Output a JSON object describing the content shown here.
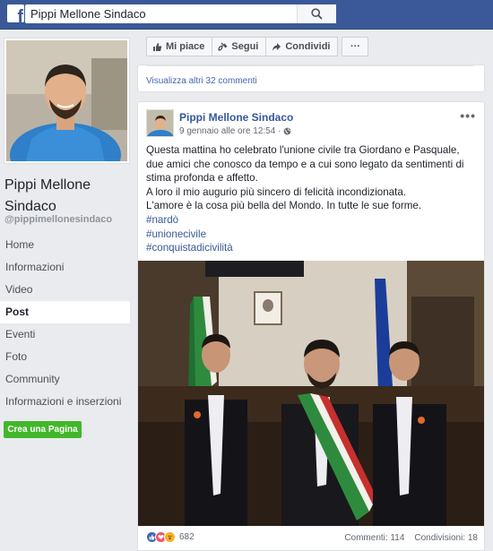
{
  "search": {
    "value": "Pippi Mellone Sindaco",
    "logo": "f"
  },
  "profile": {
    "name": "Pippi Mellone Sindaco",
    "handle": "@pippimellonesindaco"
  },
  "nav": {
    "items": [
      {
        "label": "Home"
      },
      {
        "label": "Informazioni"
      },
      {
        "label": "Video"
      },
      {
        "label": "Post"
      },
      {
        "label": "Eventi"
      },
      {
        "label": "Foto"
      },
      {
        "label": "Community"
      },
      {
        "label": "Informazioni e inserzioni"
      }
    ],
    "active": "Post"
  },
  "create_page_button": "Crea una Pagina",
  "actions": {
    "like": "Mi piace",
    "follow": "Segui",
    "share": "Condividi",
    "more": "···"
  },
  "comments": {
    "view_more": "Visualizza altri 32 commenti"
  },
  "post": {
    "author": "Pippi Mellone Sindaco",
    "timestamp": "9 gennaio alle ore 12:54 ·",
    "menu": "•••",
    "text_lines": [
      "Questa mattina ho celebrato l'unione civile tra Giordano e Pasquale, due amici che conosco da tempo e a cui sono legato da sentimenti di stima profonda e affetto.",
      "A loro il mio augurio più sincero di felicità incondizionata.",
      "L'amore è la cosa più bella del Mondo. In tutte le sue forme."
    ],
    "hashtags": [
      "#nardò",
      "#unionecivile",
      "#conquistadicivilità"
    ],
    "reactions_count": "682",
    "comments_count": "Commenti: 114",
    "shares_count": "Condivisioni: 18"
  },
  "colors": {
    "brand": "#3b5998",
    "link": "#365899",
    "green": "#42b72a",
    "like": "#4267b2",
    "love": "#f25268",
    "wow": "#f7b125"
  }
}
